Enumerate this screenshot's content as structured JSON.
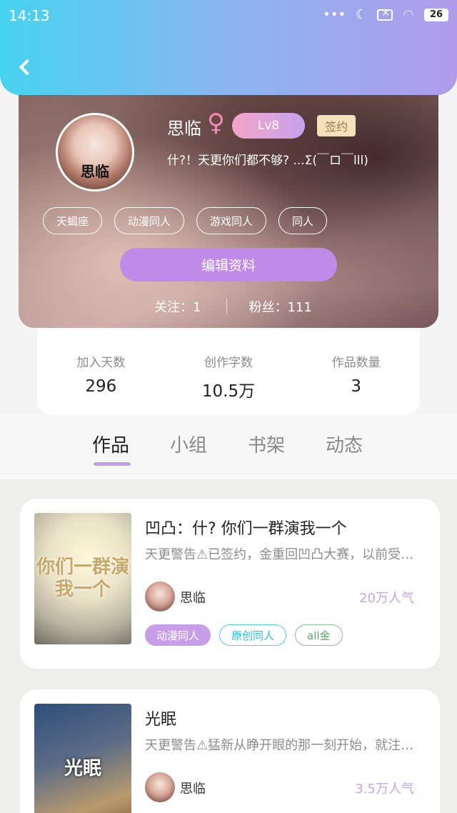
{
  "status_bar": {
    "time": "14:13",
    "dots": "•••",
    "battery": "26"
  },
  "profile": {
    "name": "思临",
    "gender_symbol": "♀",
    "level": "Lv8",
    "signed": "签约",
    "bio": "什?！天更你们都不够? ...Σ(￣ロ￣lll)",
    "avatar_text": "思临",
    "tags": [
      "天蝎座",
      "动漫同人",
      "游戏同人",
      "同人"
    ],
    "edit_label": "编辑资料",
    "following": "关注：1",
    "followers": "粉丝：111"
  },
  "stats": [
    {
      "label": "加入天数",
      "value": "296"
    },
    {
      "label": "创作字数",
      "value": "10.5万"
    },
    {
      "label": "作品数量",
      "value": "3"
    }
  ],
  "tabs": [
    {
      "label": "作品"
    },
    {
      "label": "小组"
    },
    {
      "label": "书架"
    },
    {
      "label": "动态"
    }
  ],
  "works": [
    {
      "title": "凹凸：什? 你们一群演我一个",
      "desc": "天更警告⚠已签约，金重回凹凸大赛，以前受的伤害都要加倍奉还",
      "author": "思临",
      "popularity": "20万人气",
      "cover_text": "你们一群演我一个",
      "tags": [
        "动漫同人",
        "原创同人",
        "all金"
      ]
    },
    {
      "title": "光眠",
      "desc": "天更警告⚠猛新从睁开眼的那一刻开始，就注定了",
      "author": "思临",
      "popularity": "3.5万人气",
      "cover_text": "光眠",
      "tags": []
    }
  ]
}
